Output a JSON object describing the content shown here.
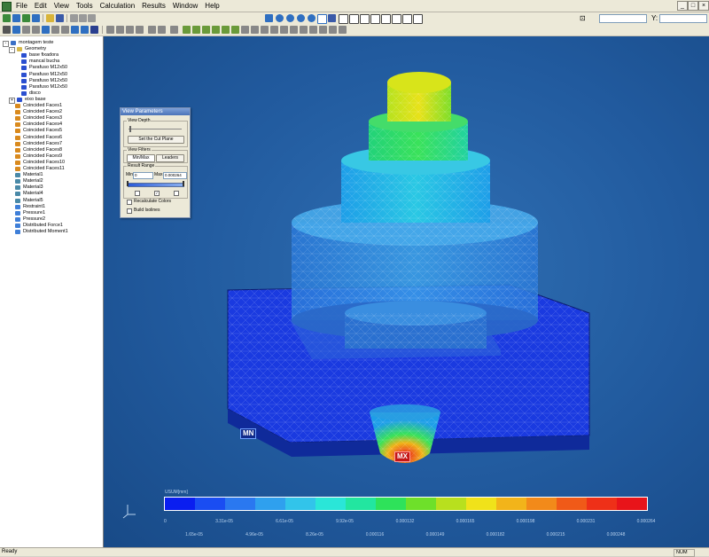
{
  "menubar": {
    "items": [
      "File",
      "Edit",
      "View",
      "Tools",
      "Calculation",
      "Results",
      "Window",
      "Help"
    ],
    "window_controls": [
      "_",
      "□",
      "×"
    ]
  },
  "coords": {
    "y_label": "Y:",
    "x_label": ""
  },
  "tree": {
    "items": [
      {
        "label": "montagem teste",
        "icon": "assembly-icon",
        "color": "#3a6fc6",
        "level": 0,
        "expander": "-"
      },
      {
        "label": "Geometry",
        "icon": "folder-icon",
        "color": "#d6b84a",
        "level": 1,
        "expander": "-"
      },
      {
        "label": "base fixadora",
        "icon": "part-icon",
        "color": "#2a4fd0",
        "level": 2
      },
      {
        "label": "mancal bucha",
        "icon": "part-icon",
        "color": "#2a4fd0",
        "level": 2
      },
      {
        "label": "Parafuso M12x50",
        "icon": "part-icon",
        "color": "#2a4fd0",
        "level": 2
      },
      {
        "label": "Parafuso M12x50",
        "icon": "part-icon",
        "color": "#2a4fd0",
        "level": 2
      },
      {
        "label": "Parafuso M12x50",
        "icon": "part-icon",
        "color": "#2a4fd0",
        "level": 2
      },
      {
        "label": "Parafuso M12x50",
        "icon": "part-icon",
        "color": "#2a4fd0",
        "level": 2
      },
      {
        "label": "disco",
        "icon": "part-icon",
        "color": "#2a4fd0",
        "level": 2
      },
      {
        "label": "eixo base",
        "icon": "part-icon",
        "color": "#2a4fd0",
        "level": 1,
        "expander": "+"
      },
      {
        "label": "Coincided Faces1",
        "icon": "contact-icon",
        "color": "#d98a1e",
        "level": 1
      },
      {
        "label": "Coincided Faces2",
        "icon": "contact-icon",
        "color": "#d98a1e",
        "level": 1
      },
      {
        "label": "Coincided Faces3",
        "icon": "contact-icon",
        "color": "#d98a1e",
        "level": 1
      },
      {
        "label": "Coincided Faces4",
        "icon": "contact-icon",
        "color": "#d98a1e",
        "level": 1
      },
      {
        "label": "Coincided Faces5",
        "icon": "contact-icon",
        "color": "#d98a1e",
        "level": 1
      },
      {
        "label": "Coincided Faces6",
        "icon": "contact-icon",
        "color": "#d98a1e",
        "level": 1
      },
      {
        "label": "Coincided Faces7",
        "icon": "contact-icon",
        "color": "#d98a1e",
        "level": 1
      },
      {
        "label": "Coincided Faces8",
        "icon": "contact-icon",
        "color": "#d98a1e",
        "level": 1
      },
      {
        "label": "Coincided Faces9",
        "icon": "contact-icon",
        "color": "#d98a1e",
        "level": 1
      },
      {
        "label": "Coincided Faces10",
        "icon": "contact-icon",
        "color": "#d98a1e",
        "level": 1
      },
      {
        "label": "Coincided Faces11",
        "icon": "contact-icon",
        "color": "#d98a1e",
        "level": 1
      },
      {
        "label": "Material1",
        "icon": "material-icon",
        "color": "#4a8aa8",
        "level": 1
      },
      {
        "label": "Material2",
        "icon": "material-icon",
        "color": "#4a8aa8",
        "level": 1
      },
      {
        "label": "Material3",
        "icon": "material-icon",
        "color": "#4a8aa8",
        "level": 1
      },
      {
        "label": "Material4",
        "icon": "material-icon",
        "color": "#4a8aa8",
        "level": 1
      },
      {
        "label": "Material5",
        "icon": "material-icon",
        "color": "#4a8aa8",
        "level": 1
      },
      {
        "label": "Restraint1",
        "icon": "restraint-icon",
        "color": "#3f7fd8",
        "level": 1
      },
      {
        "label": "Pressure1",
        "icon": "pressure-icon",
        "color": "#3f7fd8",
        "level": 1
      },
      {
        "label": "Pressure2",
        "icon": "pressure-icon",
        "color": "#3f7fd8",
        "level": 1
      },
      {
        "label": "Distributed Force1",
        "icon": "force-icon",
        "color": "#3f7fd8",
        "level": 1
      },
      {
        "label": "Distributed Moment1",
        "icon": "moment-icon",
        "color": "#3f7fd8",
        "level": 1
      }
    ]
  },
  "dialog": {
    "title": "View Parameters",
    "view_depth_group": "View Depth",
    "cut_plane_button": "Set the Cut Plane",
    "view_filters_group": "View Filters",
    "tab_minmax": "Min/Max",
    "tab_leaders": "Leaders",
    "result_range_group": "Result Range",
    "min_label": "Min",
    "min_value": "0",
    "max_label": "Max",
    "max_value": "0.000264",
    "recalculate_label": "Recalculate Colors",
    "build_isolines_label": "Build Isolines"
  },
  "model": {
    "min_tag": "MN",
    "max_tag": "MX"
  },
  "legend": {
    "title": "USUM[mm]",
    "colors": [
      "#0a1ef0",
      "#1a4df2",
      "#2a78f0",
      "#2fa0ee",
      "#32c4ea",
      "#2ae6d8",
      "#22e6a0",
      "#2ee25a",
      "#6ee02a",
      "#b8e01e",
      "#f0e21a",
      "#f2b41a",
      "#f28a1a",
      "#f05a18",
      "#ee3018",
      "#e8141a"
    ],
    "top_labels": [
      "0",
      "3.31e-05",
      "6.61e-05",
      "9.92e-05",
      "0.000132",
      "0.000165",
      "0.000198",
      "0.000231",
      "0.000264"
    ],
    "bottom_labels": [
      "1.65e-05",
      "4.96e-05",
      "8.26e-05",
      "0.000116",
      "0.000149",
      "0.000182",
      "0.000215",
      "0.000248"
    ]
  },
  "status": {
    "text": "Ready",
    "num": "NUM"
  }
}
